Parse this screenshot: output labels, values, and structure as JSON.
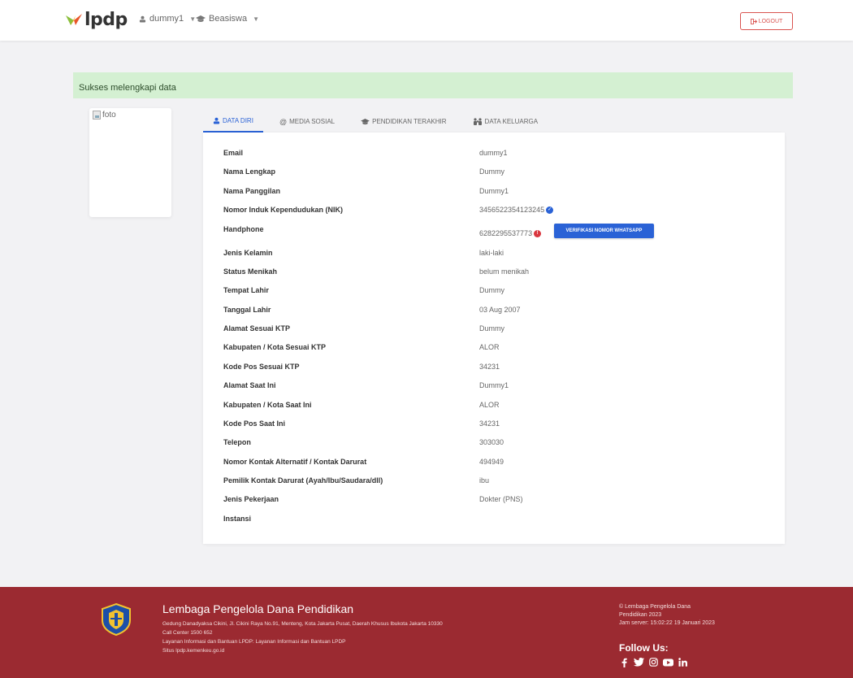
{
  "navbar": {
    "logo_text": "lpdp",
    "user_menu": "dummy1",
    "beasiswa_menu": "Beasiswa",
    "logout_label": "LOGOUT"
  },
  "alert": {
    "message": "Sukses melengkapi data"
  },
  "photo": {
    "alt": "foto"
  },
  "tabs": [
    {
      "label": "DATA DIRI",
      "icon": "user-icon",
      "active": true
    },
    {
      "label": "MEDIA SOSIAL",
      "icon": "at-icon",
      "active": false
    },
    {
      "label": "PENDIDIKAN TERAKHIR",
      "icon": "graduation-cap-icon",
      "active": false
    },
    {
      "label": "DATA KELUARGA",
      "icon": "family-icon",
      "active": false
    }
  ],
  "fields": [
    {
      "label": "Email",
      "value": "dummy1"
    },
    {
      "label": "Nama Lengkap",
      "value": "Dummy"
    },
    {
      "label": "Nama Panggilan",
      "value": "Dummy1"
    },
    {
      "label": "Nomor Induk Kependudukan (NIK)",
      "value": "3456522354123245"
    },
    {
      "label": "Handphone",
      "value": "6282295537773"
    },
    {
      "label": "Jenis Kelamin",
      "value": "laki-laki"
    },
    {
      "label": "Status Menikah",
      "value": "belum menikah"
    },
    {
      "label": "Tempat Lahir",
      "value": "Dummy"
    },
    {
      "label": "Tanggal Lahir",
      "value": "03 Aug 2007"
    },
    {
      "label": "Alamat Sesuai KTP",
      "value": "Dummy"
    },
    {
      "label": "Kabupaten / Kota Sesuai KTP",
      "value": "ALOR"
    },
    {
      "label": "Kode Pos Sesuai KTP",
      "value": "34231"
    },
    {
      "label": "Alamat Saat Ini",
      "value": "Dummy1"
    },
    {
      "label": "Kabupaten / Kota Saat Ini",
      "value": "ALOR"
    },
    {
      "label": "Kode Pos Saat Ini",
      "value": "34231"
    },
    {
      "label": "Telepon",
      "value": "303030"
    },
    {
      "label": "Nomor Kontak Alternatif / Kontak Darurat",
      "value": "494949"
    },
    {
      "label": "Pemilik Kontak Darurat (Ayah/Ibu/Saudara/dll)",
      "value": "ibu"
    },
    {
      "label": "Jenis Pekerjaan",
      "value": "Dokter (PNS)"
    },
    {
      "label": "Instansi",
      "value": ""
    }
  ],
  "verify_whatsapp_label": "VERIFIKASI NOMOR WHATSAPP",
  "footer": {
    "title": "Lembaga Pengelola Dana Pendidikan",
    "address": "Gedung Danadyaksa Cikini, Jl. Cikini Raya No.91, Menteng, Kota Jakarta Pusat, Daerah Khusus Ibukota Jakarta 10330",
    "call_center": "Call Center 1500 652",
    "layanan": "Layanan Informasi dan Bantuan LPDP: Layanan Informasi dan Bantuan LPDP",
    "situs": "Situs lpdp.kemenkeu.go.id",
    "copyright_1": "© Lembaga Pengelola Dana",
    "copyright_2": "Pendidikan 2023",
    "server_time": "Jam server: 15:02:22 19 Januari 2023",
    "follow_us": "Follow Us:",
    "socials": [
      "facebook-icon",
      "twitter-icon",
      "instagram-icon",
      "youtube-icon",
      "linkedin-icon"
    ]
  },
  "colors": {
    "primary": "#2a62d6",
    "danger": "#d9534f",
    "footer_bg": "#9b2a31",
    "alert_bg": "#d4f0d2"
  }
}
